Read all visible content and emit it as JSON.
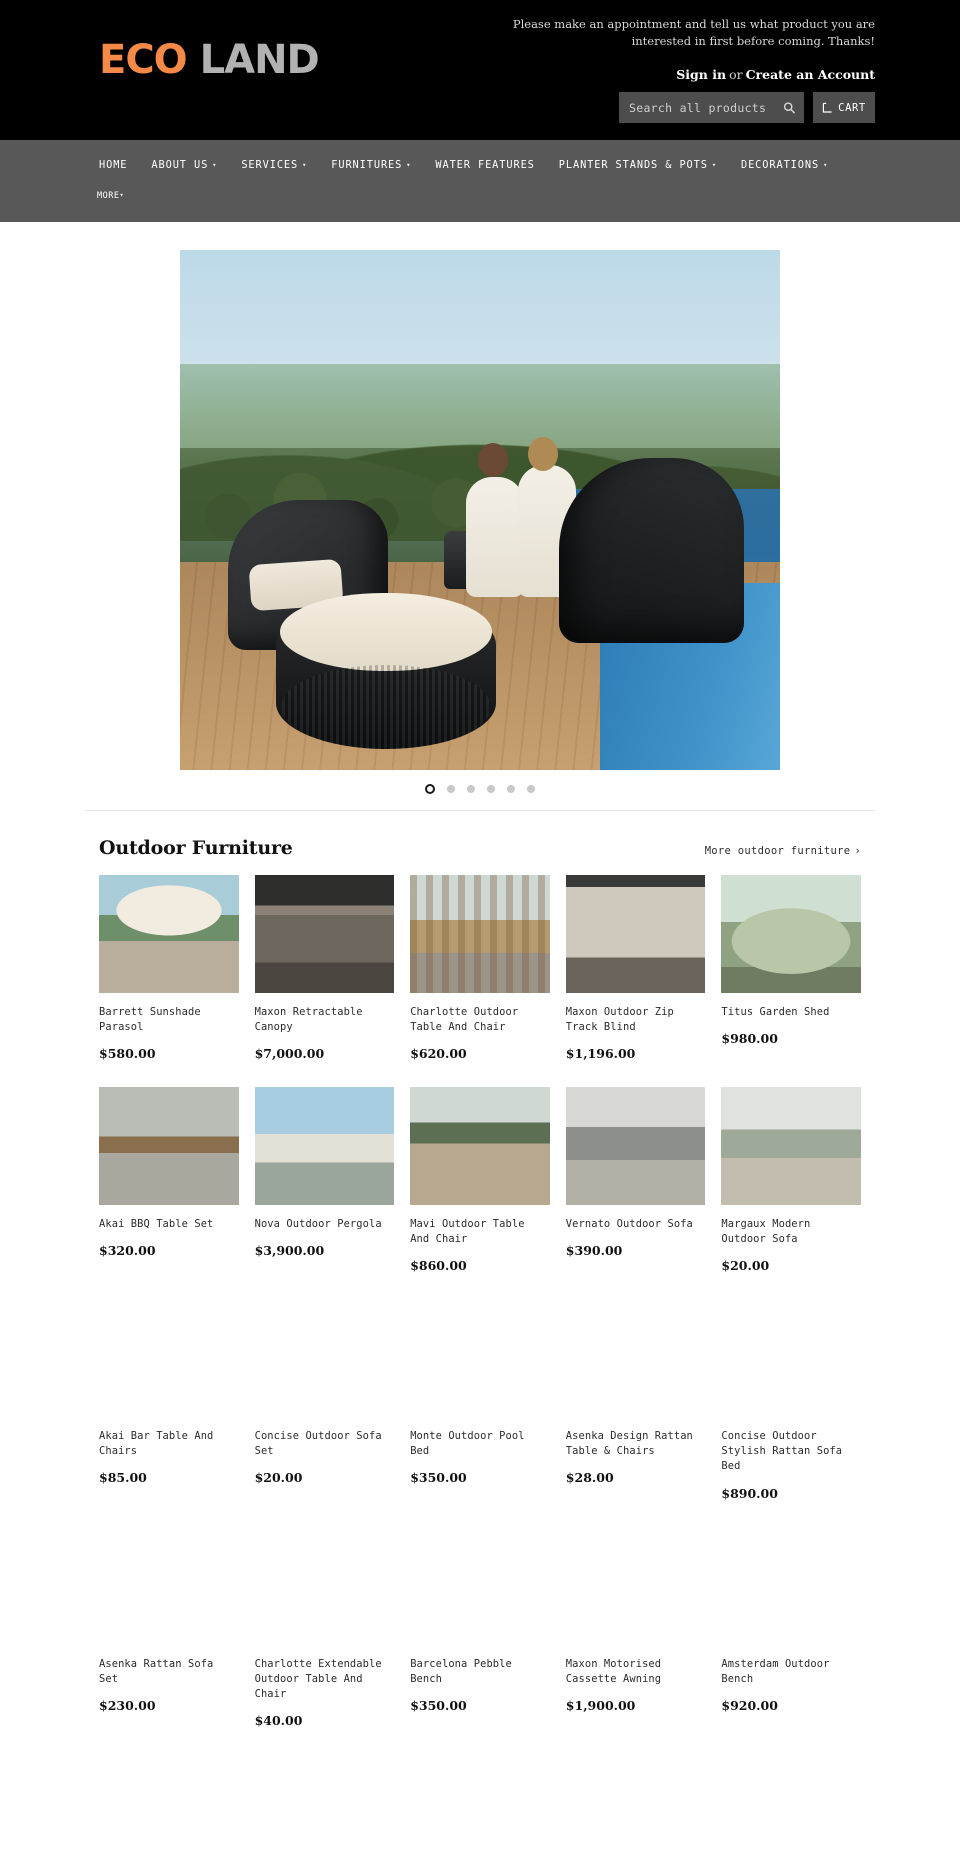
{
  "header": {
    "logo": {
      "part1": "ECO",
      "part2": "LAND"
    },
    "announcement": "Please make an appointment and tell us what product you are interested in first before coming. Thanks!",
    "sign_in": "Sign in",
    "or": "or",
    "create_account": "Create an Account",
    "search_placeholder": "Search all products...",
    "search_icon": "search-icon",
    "cart_label": "CART",
    "cart_icon": "cart-icon",
    "colors": {
      "accent": "#f58a48",
      "logo_secondary": "#b2b2b2",
      "topbar_bg": "#000000",
      "nav_bg": "#585858",
      "field_bg": "#4d4d4d"
    }
  },
  "nav": {
    "items": [
      {
        "label": "HOME",
        "has_dropdown": false
      },
      {
        "label": "ABOUT US",
        "has_dropdown": true
      },
      {
        "label": "SERVICES",
        "has_dropdown": true
      },
      {
        "label": "FURNITURES",
        "has_dropdown": true
      },
      {
        "label": "WATER FEATURES",
        "has_dropdown": false
      },
      {
        "label": "PLANTER STANDS & POTS",
        "has_dropdown": true
      },
      {
        "label": "DECORATIONS",
        "has_dropdown": true
      },
      {
        "label": "MORE",
        "has_dropdown": true
      }
    ],
    "caret": "▾"
  },
  "carousel": {
    "slide_count": 6,
    "active_index": 0
  },
  "section": {
    "title": "Outdoor Furniture",
    "more_link": "More outdoor furniture",
    "more_chevron": "›"
  },
  "products": [
    {
      "title": "Barrett Sunshade Parasol",
      "price": "$580.00",
      "thumb": "t-parasol"
    },
    {
      "title": "Maxon Retractable Canopy",
      "price": "$7,000.00",
      "thumb": "t-canopy"
    },
    {
      "title": "Charlotte Outdoor Table And Chair",
      "price": "$620.00",
      "thumb": "t-table-chair"
    },
    {
      "title": "Maxon Outdoor Zip Track Blind",
      "price": "$1,196.00",
      "thumb": "t-zip-blind"
    },
    {
      "title": "Titus Garden Shed",
      "price": "$980.00",
      "thumb": "t-shed"
    },
    {
      "title": "Akai BBQ Table Set",
      "price": "$320.00",
      "thumb": "t-bbq"
    },
    {
      "title": "Nova Outdoor Pergola",
      "price": "$3,900.00",
      "thumb": "t-pergola"
    },
    {
      "title": "Mavi Outdoor Table And Chair",
      "price": "$860.00",
      "thumb": "t-mavi"
    },
    {
      "title": "Vernato Outdoor Sofa",
      "price": "$390.00",
      "thumb": "t-vernato"
    },
    {
      "title": "Margaux Modern Outdoor Sofa",
      "price": "$20.00",
      "thumb": "t-margaux"
    },
    {
      "title": "Akai Bar Table And Chairs",
      "price": "$85.00",
      "thumb": "blank"
    },
    {
      "title": "Concise Outdoor Sofa Set",
      "price": "$20.00",
      "thumb": "blank"
    },
    {
      "title": "Monte Outdoor Pool Bed",
      "price": "$350.00",
      "thumb": "blank"
    },
    {
      "title": "Asenka Design Rattan Table & Chairs",
      "price": "$28.00",
      "thumb": "blank"
    },
    {
      "title": "Concise Outdoor Stylish Rattan Sofa Bed",
      "price": "$890.00",
      "thumb": "blank"
    },
    {
      "title": "Asenka Rattan Sofa Set",
      "price": "$230.00",
      "thumb": "blank"
    },
    {
      "title": "Charlotte Extendable Outdoor Table And Chair",
      "price": "$40.00",
      "thumb": "blank"
    },
    {
      "title": "Barcelona Pebble Bench",
      "price": "$350.00",
      "thumb": "blank"
    },
    {
      "title": "Maxon Motorised Cassette Awning",
      "price": "$1,900.00",
      "thumb": "blank"
    },
    {
      "title": "Amsterdam Outdoor Bench",
      "price": "$920.00",
      "thumb": "blank"
    }
  ]
}
